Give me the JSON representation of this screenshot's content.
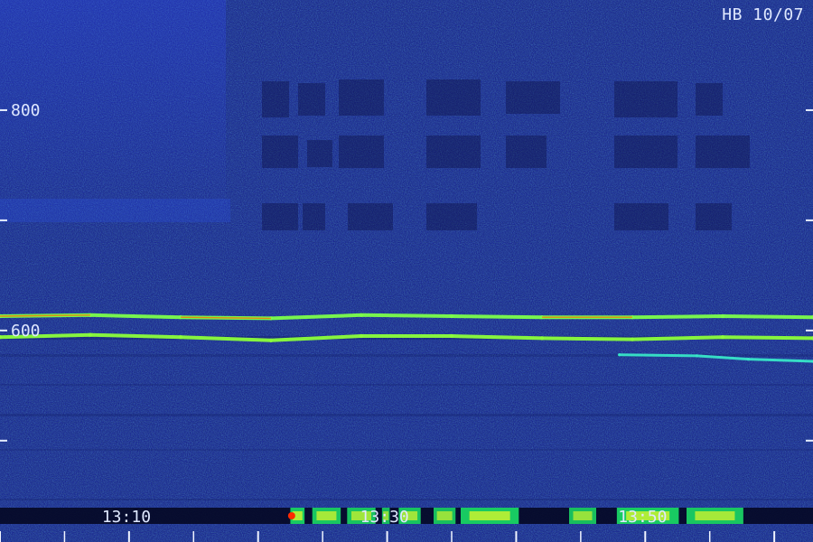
{
  "station_label": "HB 10/07",
  "chart_data": {
    "type": "heatmap",
    "title": "",
    "xlabel": "",
    "ylabel": "",
    "x_tick_labels": [
      {
        "text": "13:10",
        "minute": 10
      },
      {
        "text": "13:30",
        "minute": 30
      },
      {
        "text": "13:50",
        "minute": 50
      }
    ],
    "y_tick_labels": [
      {
        "text": "800",
        "value": 800
      },
      {
        "text": "600",
        "value": 600
      }
    ],
    "y_minor_ticks": [
      800,
      700,
      600,
      500
    ],
    "series": [
      {
        "color": "#7cff4a",
        "points": [
          [
            0,
            613
          ],
          [
            7,
            614
          ],
          [
            14,
            612
          ],
          [
            21,
            611
          ],
          [
            28,
            614
          ],
          [
            35,
            613
          ],
          [
            42,
            612
          ],
          [
            49,
            612
          ],
          [
            56,
            613
          ],
          [
            63,
            612
          ]
        ]
      },
      {
        "color": "#8cff3a",
        "points": [
          [
            0,
            594
          ],
          [
            7,
            596
          ],
          [
            14,
            594
          ],
          [
            21,
            591
          ],
          [
            28,
            595
          ],
          [
            35,
            595
          ],
          [
            42,
            593
          ],
          [
            49,
            592
          ],
          [
            56,
            594
          ],
          [
            63,
            593
          ]
        ]
      },
      {
        "color": "#38e6c8",
        "points": [
          [
            48,
            578
          ],
          [
            54,
            577
          ],
          [
            58,
            574
          ],
          [
            63,
            572
          ]
        ]
      }
    ],
    "activity_bursts": [
      {
        "start": 22.5,
        "end": 23.6,
        "strength": 1.0
      },
      {
        "start": 24.2,
        "end": 26.4,
        "strength": 0.95
      },
      {
        "start": 26.9,
        "end": 29.1,
        "strength": 0.9
      },
      {
        "start": 29.6,
        "end": 30.2,
        "strength": 0.8
      },
      {
        "start": 30.9,
        "end": 32.6,
        "strength": 0.9
      },
      {
        "start": 33.6,
        "end": 35.3,
        "strength": 0.85
      },
      {
        "start": 35.7,
        "end": 40.2,
        "strength": 1.0
      },
      {
        "start": 44.1,
        "end": 46.2,
        "strength": 0.85
      },
      {
        "start": 47.8,
        "end": 52.6,
        "strength": 1.0
      },
      {
        "start": 53.2,
        "end": 57.6,
        "strength": 0.95
      }
    ],
    "colors": {
      "background": "#11158e",
      "noise_low": "#1a24b8",
      "noise_mid": "#2a56ff",
      "noise_high": "#1ec8ff",
      "hot": "#ff6a00",
      "bright": "#ffff20"
    }
  }
}
